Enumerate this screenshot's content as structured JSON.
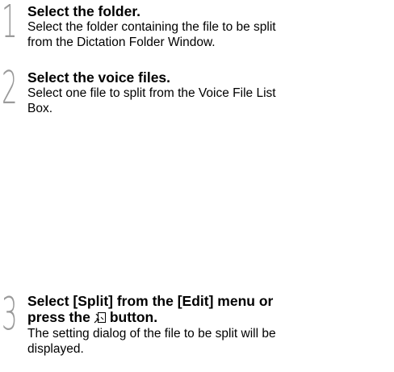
{
  "steps": [
    {
      "number": "1",
      "title": "Select the folder.",
      "body_line1": "Select the folder containing the file to be split",
      "body_line2": "from the Dictation Folder Window."
    },
    {
      "number": "2",
      "title": "Select the voice files.",
      "body_line1": "Select one file to split from the Voice File List",
      "body_line2": "Box."
    },
    {
      "number": "3",
      "title_line1": "Select [Split] from the [Edit] menu or",
      "title_line2_before": "press the",
      "title_line2_icon": "split-icon",
      "title_line2_after": "button.",
      "body_line1": "The setting dialog of the file to be split will be",
      "body_line2": "displayed."
    }
  ]
}
